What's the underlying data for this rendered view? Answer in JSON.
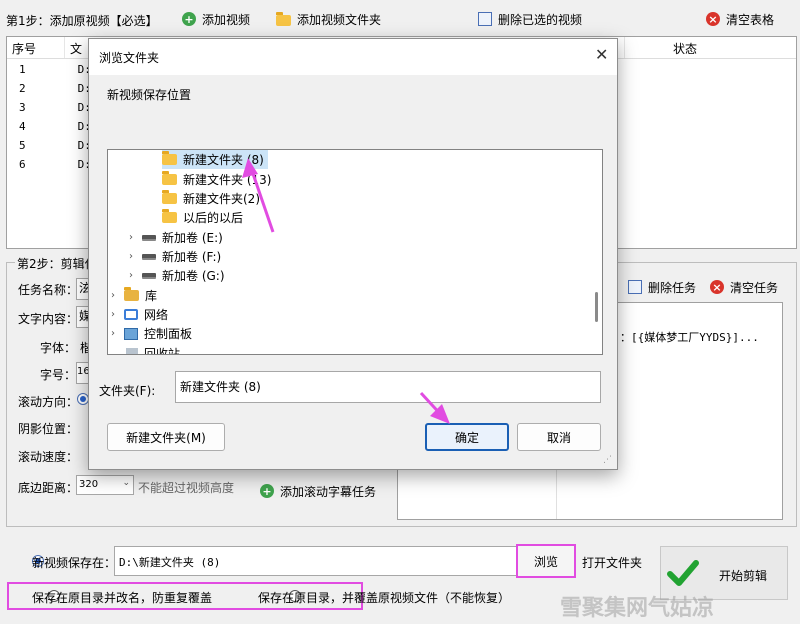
{
  "toolbar": {
    "step1_label": "第1步：添加原视频【必选】",
    "add_video": "添加视频",
    "add_folder": "添加视频文件夹",
    "delete_selected": "删除已选的视频",
    "clear_table": "清空表格"
  },
  "video_table": {
    "headers": [
      "序号",
      "文",
      "状态"
    ],
    "rows": [
      {
        "index": "1",
        "path": "D:\\"
      },
      {
        "index": "2",
        "path": "D:\\"
      },
      {
        "index": "3",
        "path": "D:\\"
      },
      {
        "index": "4",
        "path": "D:\\"
      },
      {
        "index": "5",
        "path": "D:\\"
      },
      {
        "index": "6",
        "path": "D:\\"
      }
    ]
  },
  "step2": {
    "title": "第2步：剪辑任",
    "task_name_label": "任务名称：",
    "task_name_value": "泫",
    "text_content_label": "文字内容：",
    "text_content_value": "媒",
    "font_label": "字体：",
    "font_value": "楷",
    "font_size_label": "字号：",
    "font_size_value": "16",
    "scroll_direction_label": "滚动方向：",
    "shadow_label": "阴影位置：",
    "speed_label": "滚动速度：",
    "bottom_margin_label": "底边距离：",
    "bottom_margin_value": "320",
    "bottom_margin_hint": "不能超过视频高度",
    "add_task": "添加滚动字幕任务",
    "delete_task": "删除任务",
    "clear_tasks": "清空任务",
    "task_text": "：[{媒体梦工厂YYDS}]..."
  },
  "save": {
    "label": "新视频保存在：",
    "path": "D:\\新建文件夹 (8)",
    "browse": "浏览",
    "open_folder": "打开文件夹",
    "start": "开始剪辑",
    "option1": "保存在原目录并改名，防重复覆盖",
    "option2": "保存在原目录，并覆盖原视频文件（不能恢复）"
  },
  "watermark": "雪聚集网气姑凉",
  "dialog": {
    "title": "浏览文件夹",
    "description": "新视频保存位置",
    "tree": [
      {
        "label": "新建文件夹 (8)",
        "type": "folder",
        "selected": true
      },
      {
        "label": "新建文件夹 (13)",
        "type": "folder"
      },
      {
        "label": "新建文件夹(2)",
        "type": "folder"
      },
      {
        "label": "以后的以后",
        "type": "folder"
      },
      {
        "label": "新加卷 (E:)",
        "type": "drive"
      },
      {
        "label": "新加卷 (F:)",
        "type": "drive"
      },
      {
        "label": "新加卷 (G:)",
        "type": "drive"
      },
      {
        "label": "库",
        "type": "library"
      },
      {
        "label": "网络",
        "type": "network"
      },
      {
        "label": "控制面板",
        "type": "control"
      },
      {
        "label": "回收站",
        "type": "recycle"
      }
    ],
    "folder_label": "文件夹(F):",
    "folder_value": "新建文件夹 (8)",
    "new_folder": "新建文件夹(M)",
    "ok": "确定",
    "cancel": "取消"
  },
  "colors": {
    "highlight": "#e14ce1",
    "accent": "#1a5fb4",
    "arrow": "#e14ce1"
  }
}
